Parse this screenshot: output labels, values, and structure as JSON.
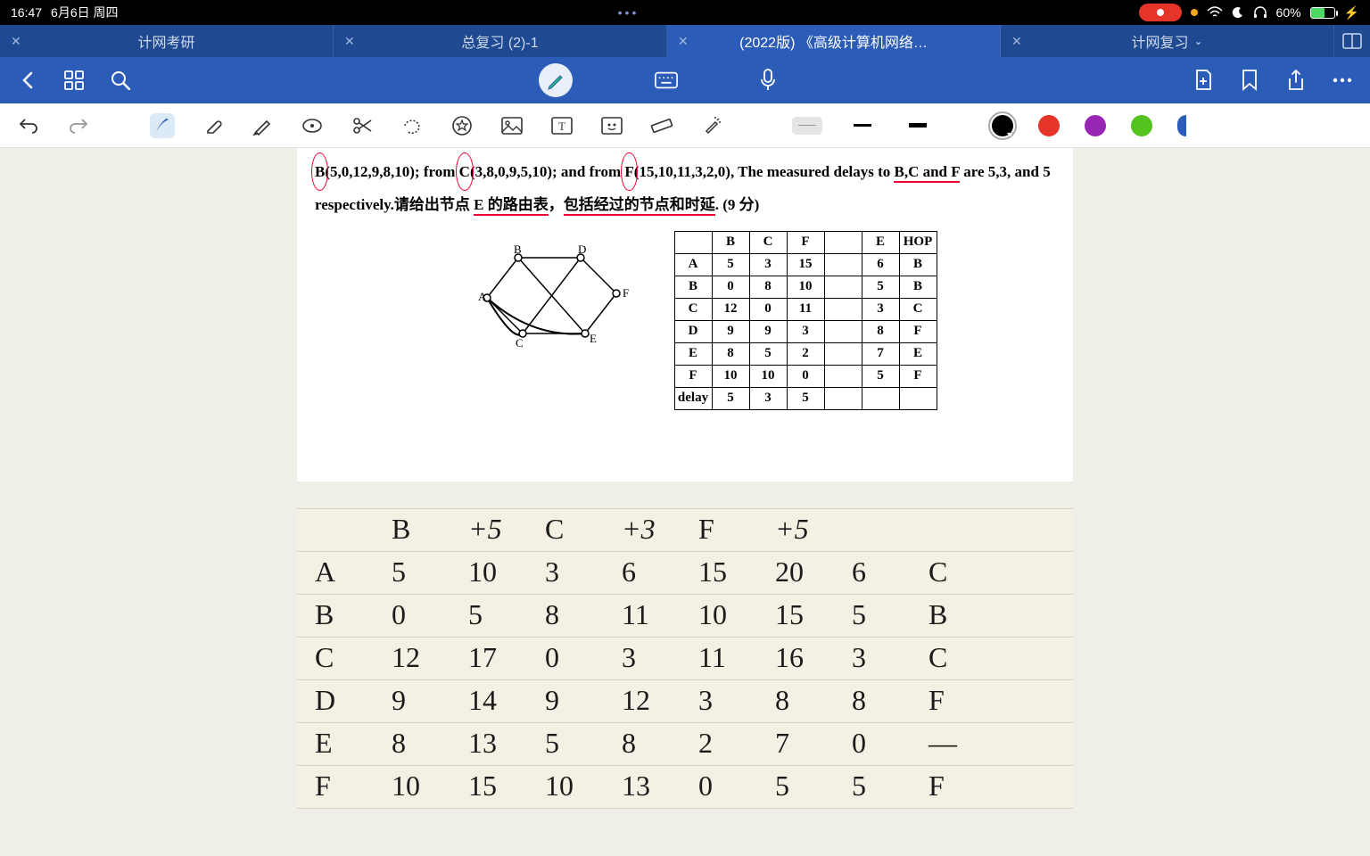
{
  "status_bar": {
    "time": "16:47",
    "date": "6月6日 周四",
    "dots": "•••",
    "battery_pct": "60%",
    "charging": true
  },
  "tabs": [
    {
      "label": "计网考研",
      "active": false
    },
    {
      "label": "总复习 (2)-1",
      "active": false
    },
    {
      "label": "(2022版) 《高级计算机网络…",
      "active": true
    },
    {
      "label": "计网复习",
      "active": false,
      "dropdown": true
    }
  ],
  "problem": {
    "line1_pre": "B",
    "line1_b_vec": "(5,0,12,9,8,10)",
    "line1_mid1": "; from ",
    "line1_c": "C",
    "line1_c_vec": "(3,8,0,9,5,10)",
    "line1_mid2": "; and from ",
    "line1_f": "F",
    "line1_f_vec": "(15,10,11,3,2,0)",
    "line1_mid3": ", The measured delays to ",
    "line1_bcf": "B,C and F",
    "line1_end": " are 5,3, and 5",
    "line2_pre": "respectively.请给出节点 ",
    "line2_e": "E 的路由表",
    "line2_mid": "，",
    "line2_ul": "包括经过的节点和时延",
    "line2_end": ". (9 分)"
  },
  "graph_nodes": [
    "A",
    "B",
    "C",
    "D",
    "E",
    "F"
  ],
  "chart_data": {
    "type": "table",
    "title": "Routing table at node E",
    "columns": [
      "",
      "B",
      "C",
      "F",
      "",
      "E",
      "HOP"
    ],
    "rows": [
      [
        "A",
        "5",
        "3",
        "15",
        "",
        "6",
        "B"
      ],
      [
        "B",
        "0",
        "8",
        "10",
        "",
        "5",
        "B"
      ],
      [
        "C",
        "12",
        "0",
        "11",
        "",
        "3",
        "C"
      ],
      [
        "D",
        "9",
        "9",
        "3",
        "",
        "8",
        "F"
      ],
      [
        "E",
        "8",
        "5",
        "2",
        "",
        "7",
        "E"
      ],
      [
        "F",
        "10",
        "10",
        "0",
        "",
        "5",
        "F"
      ],
      [
        "delay",
        "5",
        "3",
        "5",
        "",
        "",
        ""
      ]
    ]
  },
  "handwriting": {
    "header": [
      "",
      "B",
      "+5",
      "C",
      "+3",
      "F",
      "+5",
      "",
      ""
    ],
    "rows": [
      [
        "A",
        "5",
        "10",
        "3",
        "6",
        "15",
        "20",
        "6",
        "C"
      ],
      [
        "B",
        "0",
        "5",
        "8",
        "11",
        "10",
        "15",
        "5",
        "B"
      ],
      [
        "C",
        "12",
        "17",
        "0",
        "3",
        "11",
        "16",
        "3",
        "C"
      ],
      [
        "D",
        "9",
        "14",
        "9",
        "12",
        "3",
        "8",
        "8",
        "F"
      ],
      [
        "E",
        "8",
        "13",
        "5",
        "8",
        "2",
        "7",
        "0",
        "—"
      ],
      [
        "F",
        "10",
        "15",
        "10",
        "13",
        "0",
        "5",
        "5",
        "F"
      ]
    ]
  },
  "colors": {
    "black": "#000000",
    "red": "#e5352b",
    "purple": "#9726b5",
    "green": "#54c320",
    "blue": "#2b5db8"
  }
}
